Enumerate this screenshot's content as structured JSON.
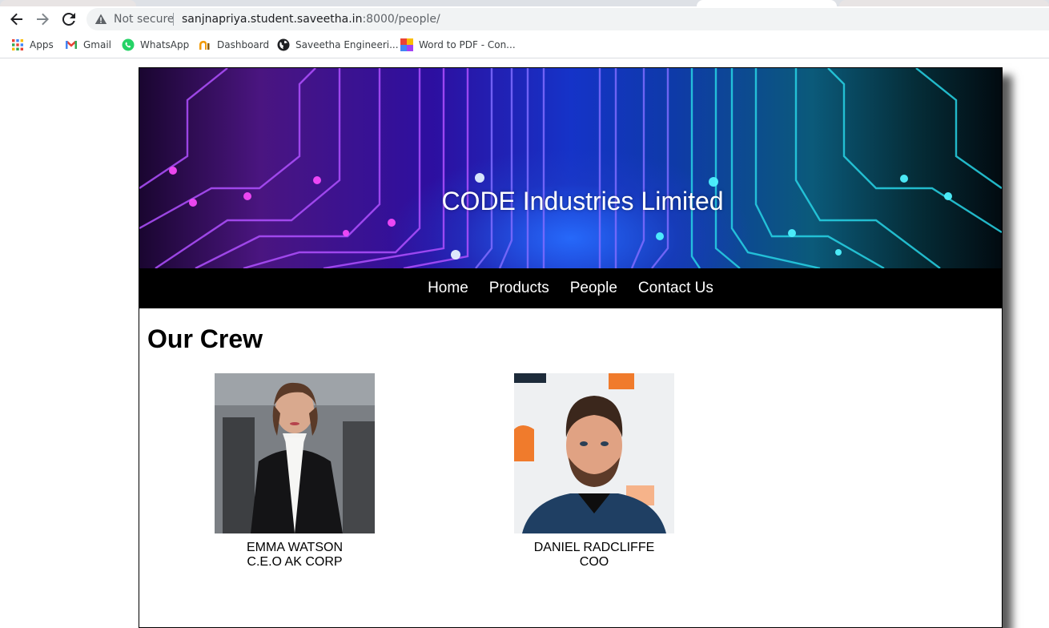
{
  "browser": {
    "security_label": "Not secure",
    "url_host": "sanjnapriya.student.saveetha.in",
    "url_path": ":8000/people/"
  },
  "bookmarks": [
    {
      "label": "Apps",
      "icon": "apps-grid-icon"
    },
    {
      "label": "Gmail",
      "icon": "gmail-icon"
    },
    {
      "label": "WhatsApp",
      "icon": "whatsapp-icon"
    },
    {
      "label": "Dashboard",
      "icon": "dashboard-icon"
    },
    {
      "label": "Saveetha Engineeri...",
      "icon": "globe-icon"
    },
    {
      "label": "Word to PDF - Con...",
      "icon": "word-to-pdf-icon"
    }
  ],
  "site": {
    "title": "CODE Industries Limited",
    "nav": [
      "Home",
      "Products",
      "People",
      "Contact Us"
    ],
    "heading": "Our Crew",
    "crew": [
      {
        "name": "EMMA WATSON",
        "role": "C.E.O AK CORP"
      },
      {
        "name": "DANIEL RADCLIFFE",
        "role": "COO"
      }
    ]
  },
  "colors": {
    "nav_background": "#000000",
    "banner_accent_purple": "#7a1fd0",
    "banner_accent_cyan": "#13c6d6"
  }
}
